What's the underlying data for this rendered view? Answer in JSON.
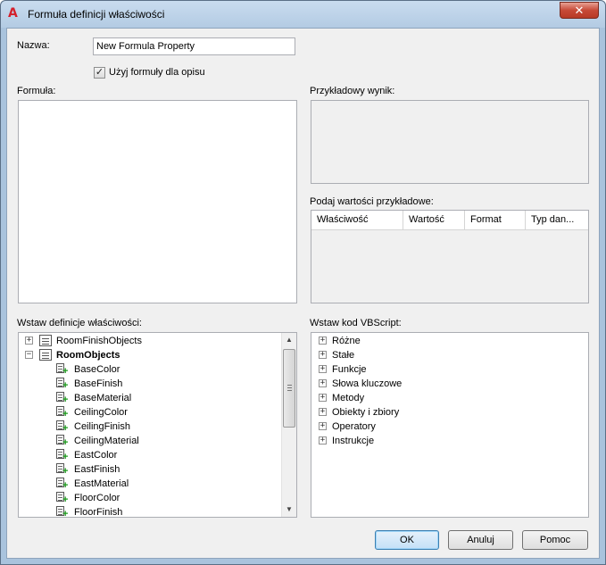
{
  "window": {
    "title": "Formuła definicji właściwości",
    "app_icon_glyph": "A",
    "close_glyph": "✕",
    "accent_color": "#d4202c"
  },
  "name_field": {
    "label": "Nazwa:",
    "value": "New Formula Property"
  },
  "use_formula_checkbox": {
    "label": "Użyj formuły dla opisu",
    "checked": true
  },
  "formula": {
    "label": "Formuła:",
    "value": ""
  },
  "sample_result": {
    "label": "Przykładowy wynik:",
    "value": ""
  },
  "sample_values": {
    "label": "Podaj wartości przykładowe:",
    "columns": [
      "Właściwość",
      "Wartość",
      "Format",
      "Typ dan..."
    ]
  },
  "property_definitions": {
    "label": "Wstaw definicje właściwości:",
    "groups": [
      {
        "name": "RoomFinishObjects",
        "expanded": false,
        "bold": false,
        "icon": "table-icon"
      },
      {
        "name": "RoomObjects",
        "expanded": true,
        "bold": true,
        "icon": "table-icon"
      }
    ],
    "items": [
      "BaseColor",
      "BaseFinish",
      "BaseMaterial",
      "CeilingColor",
      "CeilingFinish",
      "CeilingMaterial",
      "EastColor",
      "EastFinish",
      "EastMaterial",
      "FloorColor",
      "FloorFinish"
    ]
  },
  "vbscript": {
    "label": "Wstaw kod VBScript:",
    "items": [
      "Różne",
      "Stałe",
      "Funkcje",
      "Słowa kluczowe",
      "Metody",
      "Obiekty i zbiory",
      "Operatory",
      "Instrukcje"
    ]
  },
  "buttons": {
    "ok": "OK",
    "cancel": "Anuluj",
    "help": "Pomoc"
  }
}
